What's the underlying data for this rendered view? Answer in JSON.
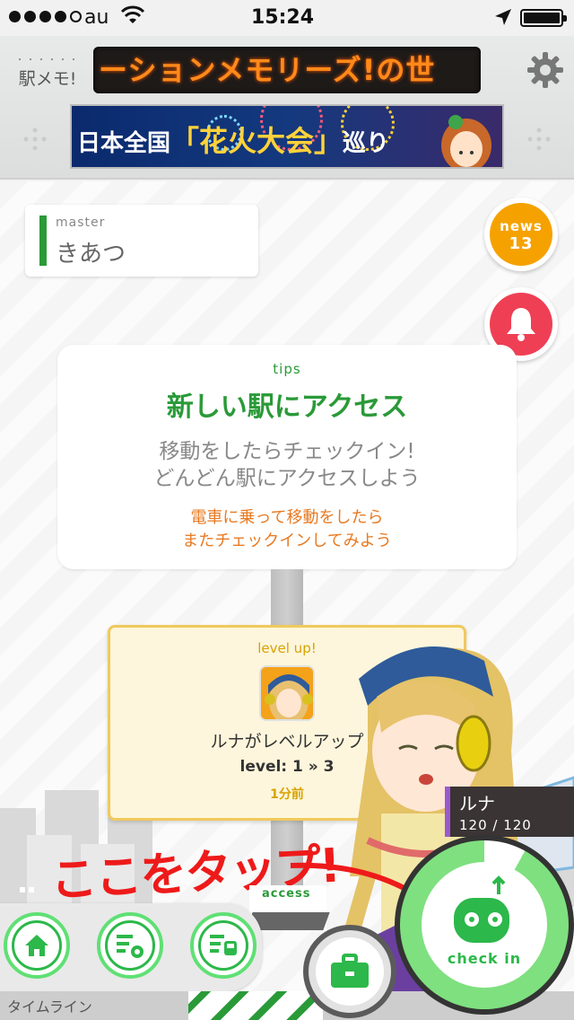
{
  "status_bar": {
    "carrier": "au",
    "time": "15:24"
  },
  "header": {
    "logo_top": "・・・・・・",
    "logo_text": "駅メモ!",
    "ticker_text": "ーションメモリーズ!の世",
    "banner_text_a": "日本全国",
    "banner_text_b": "「花火大会」",
    "banner_text_c": "巡り"
  },
  "master": {
    "label": "master",
    "name": "きあつ"
  },
  "news": {
    "label": "news",
    "count": "13"
  },
  "tips": {
    "label": "tips",
    "title": "新しい駅にアクセス",
    "body_line1": "移動をしたらチェックイン!",
    "body_line2": "どんどん駅にアクセスしよう",
    "note_line1": "電車に乗って移動をしたら",
    "note_line2": "またチェックインしてみよう"
  },
  "level_up": {
    "label": "level up!",
    "message": "ルナがレベルアップ",
    "level_text": "level: 1 » 3",
    "time": "1分前"
  },
  "character": {
    "name": "ルナ",
    "hp": "120 / 120"
  },
  "hint": "ここをタップ!",
  "access_label": "access",
  "checkin_label": "check in",
  "bottom_label": "タイムライン",
  "colors": {
    "accent_green": "#2a9a38",
    "ring_green": "#7fe07f",
    "news_orange": "#f5a200",
    "bell_red": "#ef3f55",
    "ticker_orange": "#ff8a1a",
    "hint_red": "#ee1a1a"
  }
}
